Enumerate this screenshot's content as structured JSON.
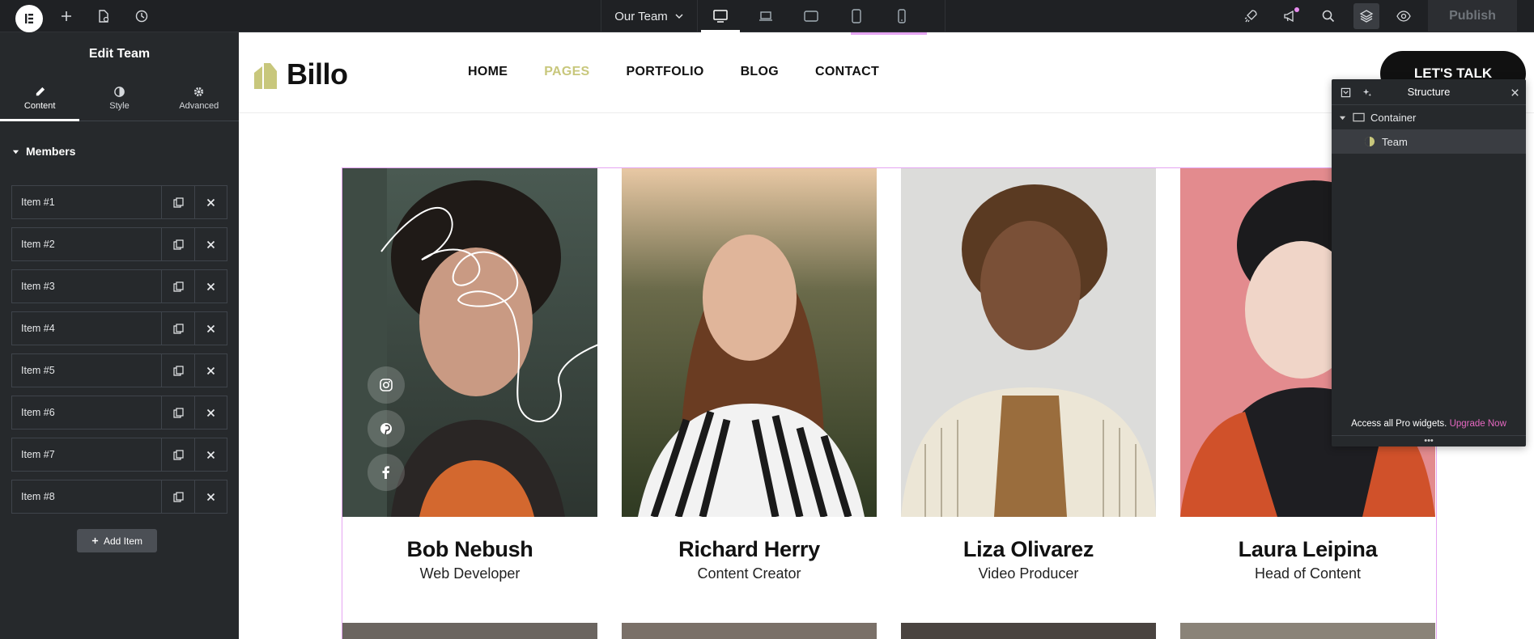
{
  "topbar": {
    "page_name": "Our Team",
    "publish_label": "Publish"
  },
  "panel": {
    "title": "Edit Team",
    "tabs": [
      {
        "label": "Content",
        "icon": "pencil-icon"
      },
      {
        "label": "Style",
        "icon": "half-circle-icon"
      },
      {
        "label": "Advanced",
        "icon": "gear-icon"
      }
    ],
    "section_label": "Members",
    "items": [
      "Item #1",
      "Item #2",
      "Item #3",
      "Item #4",
      "Item #5",
      "Item #6",
      "Item #7",
      "Item #8"
    ],
    "add_item_label": "Add Item"
  },
  "site": {
    "brand": "Billo",
    "nav": [
      {
        "label": "HOME",
        "active": false
      },
      {
        "label": "PAGES",
        "active": true
      },
      {
        "label": "PORTFOLIO",
        "active": false
      },
      {
        "label": "BLOG",
        "active": false
      },
      {
        "label": "CONTACT",
        "active": false
      }
    ],
    "cta_label": "LET'S TALK",
    "accent_color": "#c8c77c"
  },
  "team": [
    {
      "name": "Bob Nebush",
      "role": "Web Developer"
    },
    {
      "name": "Richard Herry",
      "role": "Content Creator"
    },
    {
      "name": "Liza Olivarez",
      "role": "Video Producer"
    },
    {
      "name": "Laura Leipina",
      "role": "Head of Content"
    }
  ],
  "structure": {
    "title": "Structure",
    "nodes": [
      {
        "label": "Container",
        "icon": "container-icon"
      },
      {
        "label": "Team",
        "icon": "team-widget-icon"
      }
    ],
    "footer_text": "Access all Pro widgets.",
    "upgrade_label": "Upgrade Now"
  }
}
